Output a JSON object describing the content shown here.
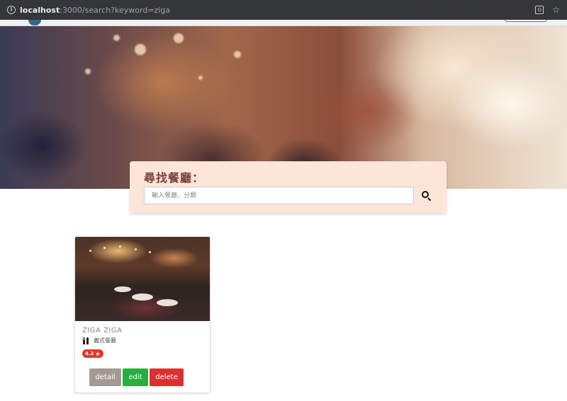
{
  "browser": {
    "url_host": "localhost",
    "url_path": ":3000/search?keyword=ziga",
    "info_icon": "info-icon",
    "translate_icon": "translate-icon",
    "bookmark_icon": "star-icon"
  },
  "search": {
    "title": "尋找餐廳：",
    "placeholder": "輸入餐廳、分類",
    "value": "",
    "button_icon": "search-icon"
  },
  "results": [
    {
      "name": "ZIGA ZIGA",
      "category": "義式餐廳",
      "category_icon": "utensils-icon",
      "rating": "4.2",
      "rating_icon": "star-icon",
      "actions": {
        "detail": "detail",
        "edit": "edit",
        "delete": "delete"
      }
    }
  ],
  "colors": {
    "search_panel_bg": "#fde5d9",
    "search_title": "#7a3e3b",
    "badge": "#e4352b",
    "btn_detail": "#a59a93",
    "btn_edit": "#27ae3f",
    "btn_delete": "#dc3030"
  }
}
